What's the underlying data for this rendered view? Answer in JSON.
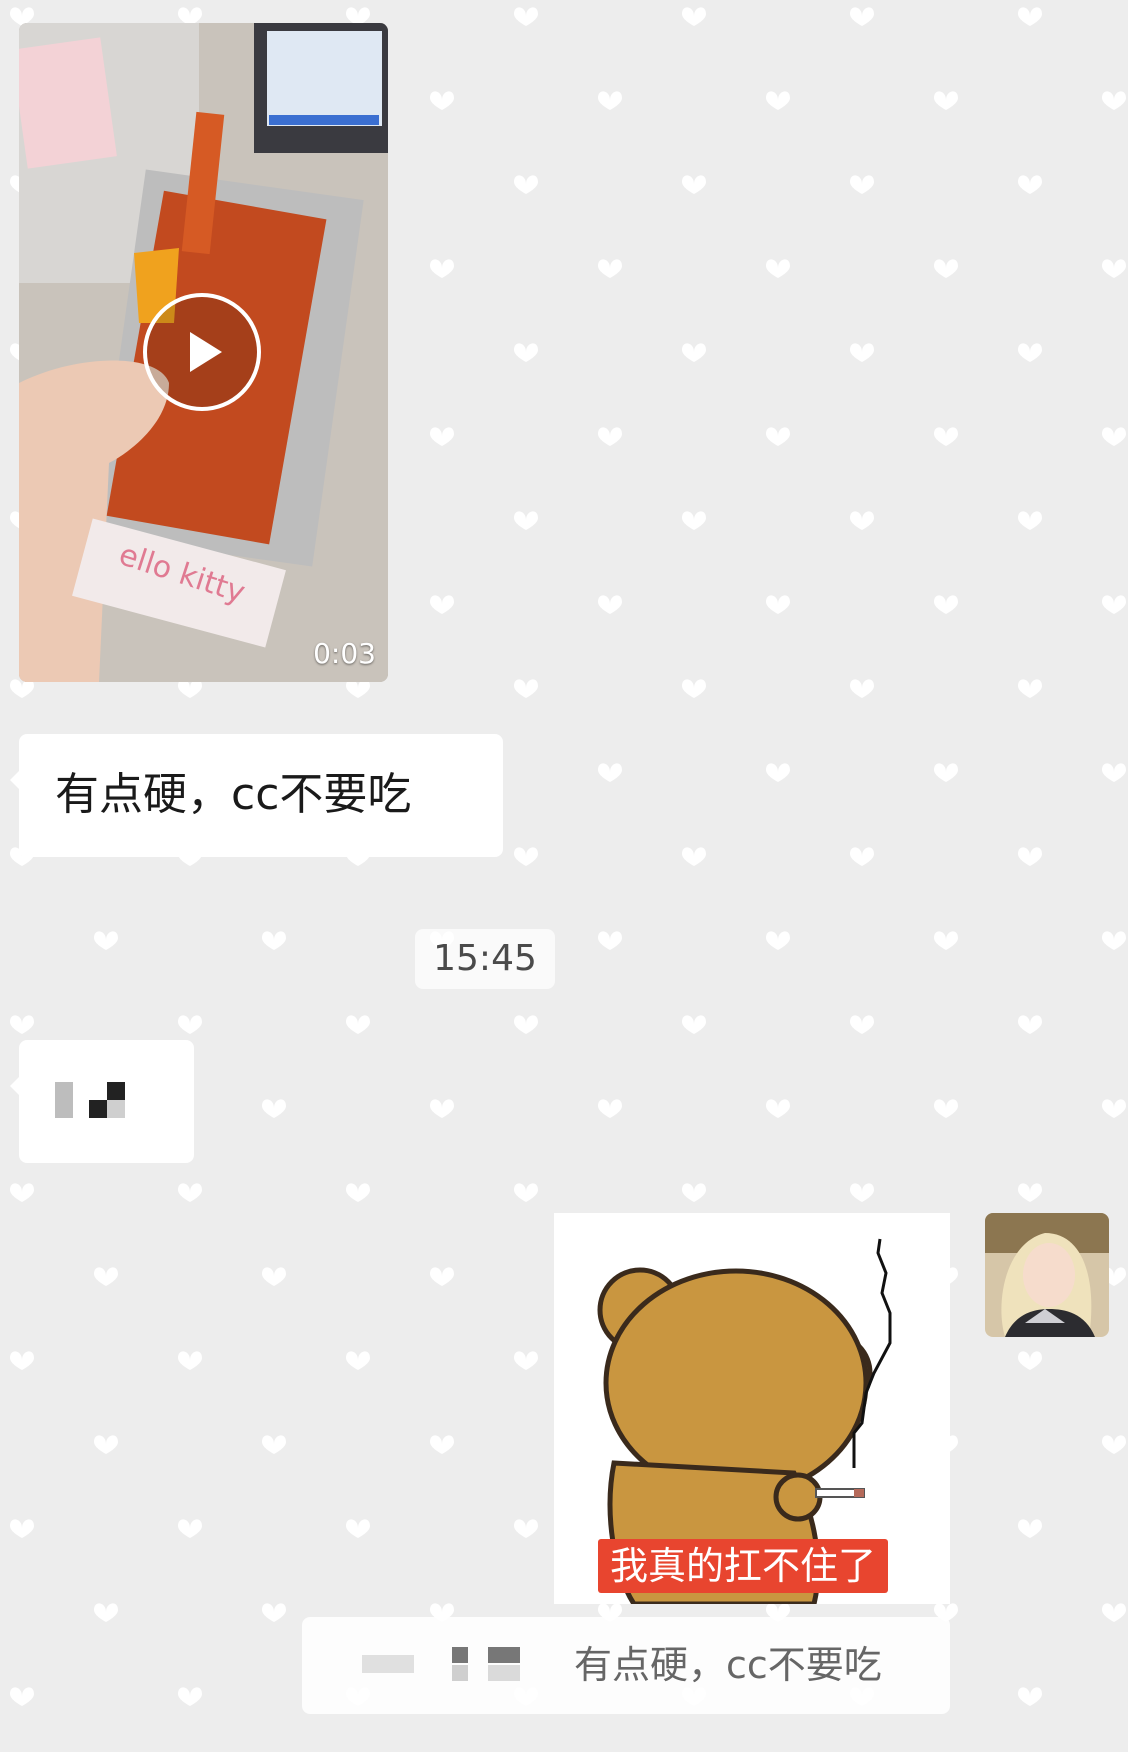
{
  "messages": {
    "video": {
      "duration": "0:03"
    },
    "text_1": "有点硬，cc不要吃",
    "timestamp": "15:45",
    "sticker": {
      "caption": "我真的扛不住了"
    },
    "quote": {
      "text": "有点硬，cc不要吃"
    }
  },
  "icons": {
    "play": "play-icon",
    "avatar": "user-avatar"
  },
  "colors": {
    "background": "#ededed",
    "bubble": "#ffffff",
    "sticker_caption_bg": "#e8452f"
  }
}
